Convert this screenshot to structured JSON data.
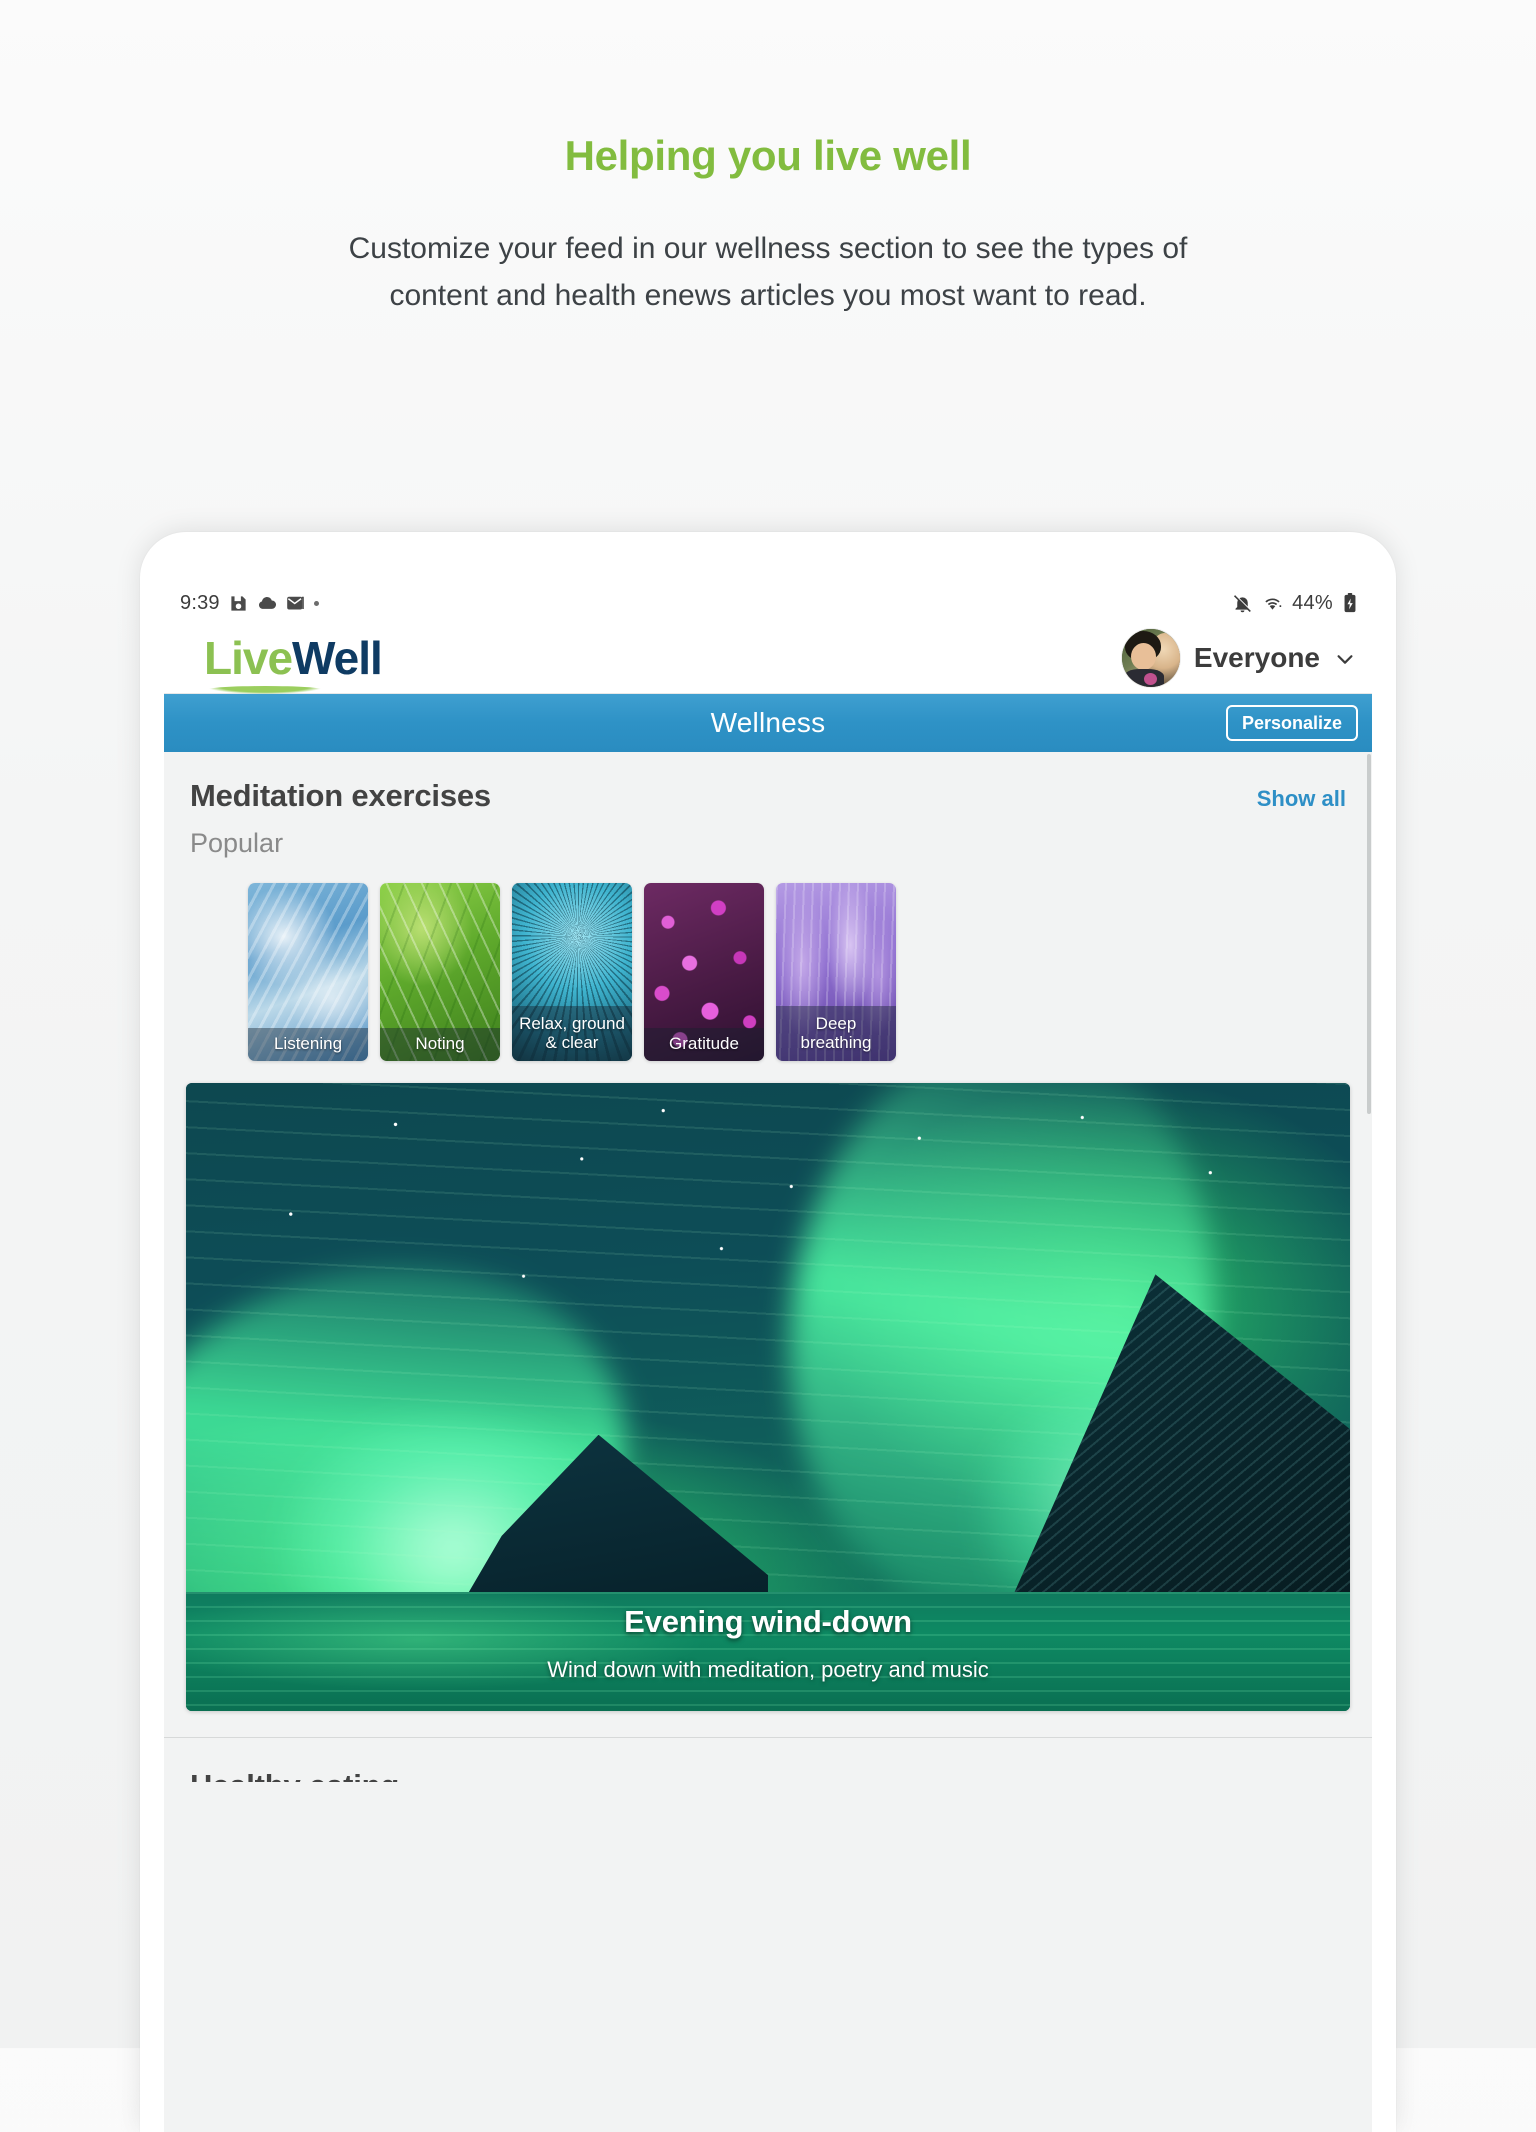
{
  "promo": {
    "title": "Helping you live well",
    "body": "Customize your feed in our wellness section to see the types of content and health enews articles you most want to read."
  },
  "status_bar": {
    "time": "9:39",
    "battery_percent": "44%",
    "icons_left": [
      "save-icon",
      "cloud-icon",
      "email-icon",
      "dot-icon"
    ],
    "icons_right": [
      "mute-bell-icon",
      "wifi-icon",
      "battery-charging-icon"
    ]
  },
  "app_header": {
    "logo_first": "Live",
    "logo_second": "Well",
    "profile_name": "Everyone",
    "logo_green": "#8cc152",
    "logo_navy": "#0f3b63"
  },
  "wellness_bar": {
    "title": "Wellness",
    "personalize_label": "Personalize",
    "accent": "#2e92c6"
  },
  "meditation": {
    "section_title": "Meditation exercises",
    "show_all_label": "Show all",
    "subheading": "Popular",
    "cards": [
      {
        "label": "Listening",
        "art": "art-feather"
      },
      {
        "label": "Noting",
        "art": "art-leaf"
      },
      {
        "label": "Relax, ground & clear",
        "art": "art-dandelion"
      },
      {
        "label": "Gratitude",
        "art": "art-flowers"
      },
      {
        "label": "Deep breathing",
        "art": "art-lavender"
      }
    ]
  },
  "hero": {
    "title": "Evening wind-down",
    "subtitle": "Wind down with meditation, poetry and music"
  },
  "next_section": {
    "title": "Healthy eating"
  }
}
